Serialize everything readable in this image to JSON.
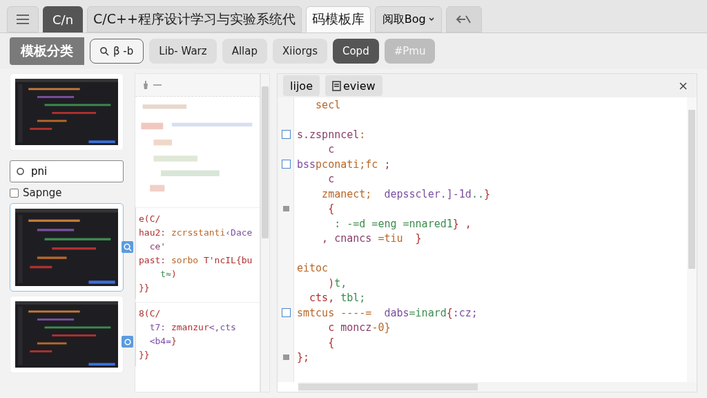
{
  "top_bar": {
    "app_badge": "C/n",
    "tabs": [
      {
        "label": "C/C++程序设计学习与实验系统代",
        "selected": false
      },
      {
        "label": "码模板库",
        "selected": true
      }
    ],
    "account_menu": {
      "label": "阅取Bog"
    }
  },
  "filter_bar": {
    "title": "模板分类",
    "filters": [
      {
        "kind": "search",
        "label": "β -b",
        "selected": false,
        "disabled": false
      },
      {
        "kind": "chip",
        "label": "Lib- Warz",
        "selected": false,
        "disabled": false
      },
      {
        "kind": "chip",
        "label": "Allap",
        "selected": false,
        "disabled": false
      },
      {
        "kind": "chip",
        "label": "Xiiorgs",
        "selected": false,
        "disabled": false
      },
      {
        "kind": "chip",
        "label": "Copd",
        "selected": true,
        "disabled": false
      },
      {
        "kind": "chip",
        "label": "#Pmu",
        "selected": false,
        "disabled": true
      }
    ]
  },
  "library": {
    "search": {
      "value": "pni"
    },
    "sample_toggle": {
      "label": "Sapnge",
      "checked": false
    },
    "cards": [
      {
        "selected": false
      },
      {
        "selected": true
      },
      {
        "selected": false
      }
    ],
    "snippets": [
      {
        "kind": "search",
        "lines": [
          [
            {
              "kind": "br",
              "text": "e(C/"
            }
          ],
          [
            {
              "kind": "br",
              "text": "hau2: "
            },
            {
              "kind": "kw",
              "text": "zcrsstanti"
            },
            {
              "kind": "fn",
              "text": "‹Dace"
            }
          ],
          [
            {
              "kind": "id",
              "text": "  ce'"
            }
          ],
          [
            {
              "kind": "br",
              "text": "past: "
            },
            {
              "kind": "kw",
              "text": "sorbo "
            },
            {
              "kind": "br",
              "text": "T'ncIL{bu"
            }
          ],
          [
            {
              "kind": "str",
              "text": "    t≈"
            },
            {
              "kind": "br",
              "text": ")"
            }
          ],
          [
            {
              "kind": "br",
              "text": "}}"
            }
          ]
        ]
      },
      {
        "kind": "circle",
        "lines": [
          [
            {
              "kind": "br",
              "text": "8(C/"
            }
          ],
          [
            {
              "kind": "fn",
              "text": "  t7: "
            },
            {
              "kind": "br",
              "text": "zmanzur"
            },
            {
              "kind": "fn",
              "text": "<,cts"
            }
          ],
          [
            {
              "kind": "fn",
              "text": "  <b4="
            },
            {
              "kind": "br",
              "text": "}"
            }
          ],
          [
            {
              "kind": "br",
              "text": "}}"
            }
          ]
        ]
      }
    ]
  },
  "editor": {
    "tabs": [
      {
        "label": "lijoe"
      },
      {
        "label": "eview"
      }
    ],
    "lines": [
      {
        "kind": "plain",
        "tokens": [
          {
            "kind": "kw",
            "text": "   secl"
          }
        ]
      },
      {
        "kind": "plain"
      },
      {
        "kind": "checkbox",
        "checked": false,
        "tokens": [
          {
            "kind": "id",
            "text": "s.zspnncel"
          },
          {
            "kind": "kw",
            "text": ":"
          }
        ]
      },
      {
        "kind": "plain",
        "tokens": [
          {
            "kind": "id",
            "text": "     c"
          }
        ]
      },
      {
        "kind": "checkbox",
        "checked": false,
        "tokens": [
          {
            "kind": "fn",
            "text": "bss"
          },
          {
            "kind": "kw",
            "text": "pconati;fc"
          },
          {
            "kind": "id",
            "text": " ;"
          }
        ]
      },
      {
        "kind": "plain",
        "tokens": [
          {
            "kind": "id",
            "text": "     c"
          }
        ]
      },
      {
        "kind": "plain",
        "tokens": [
          {
            "kind": "kw",
            "text": "    zmanect;  "
          },
          {
            "kind": "fn",
            "text": "depsscler.]-1d"
          },
          {
            "kind": "str",
            "text": ".."
          },
          {
            "kind": "br",
            "text": "}"
          }
        ]
      },
      {
        "kind": "breakpoint",
        "tokens": [
          {
            "kind": "br",
            "text": "     {"
          }
        ]
      },
      {
        "kind": "plain",
        "tokens": [
          {
            "kind": "str",
            "text": "      : -=d =eng =nnared1"
          },
          {
            "kind": "br",
            "text": "} ,"
          }
        ]
      },
      {
        "kind": "plain",
        "tokens": [
          {
            "kind": "id",
            "text": "    , cnancs "
          },
          {
            "kind": "kw",
            "text": "=tiu  "
          },
          {
            "kind": "br",
            "text": "}"
          }
        ]
      },
      {
        "kind": "plain"
      },
      {
        "kind": "plain",
        "tokens": [
          {
            "kind": "kw",
            "text": "eitoc"
          }
        ]
      },
      {
        "kind": "plain",
        "tokens": [
          {
            "kind": "br",
            "text": "     )"
          },
          {
            "kind": "str",
            "text": "t,"
          }
        ]
      },
      {
        "kind": "plain",
        "tokens": [
          {
            "kind": "br",
            "text": "  cts, "
          },
          {
            "kind": "str",
            "text": "tbl;"
          }
        ]
      },
      {
        "kind": "checkbox",
        "checked": false,
        "tokens": [
          {
            "kind": "kw",
            "text": "smtcus ----=  "
          },
          {
            "kind": "fn",
            "text": "dabs"
          },
          {
            "kind": "str",
            "text": "=inard"
          },
          {
            "kind": "br",
            "text": "{"
          },
          {
            "kind": "fn",
            "text": ":cz;"
          }
        ]
      },
      {
        "kind": "plain",
        "tokens": [
          {
            "kind": "br",
            "text": "     c "
          },
          {
            "kind": "id",
            "text": "moncz"
          },
          {
            "kind": "kw",
            "text": "-0}"
          }
        ]
      },
      {
        "kind": "plain",
        "tokens": [
          {
            "kind": "br",
            "text": "     {"
          }
        ]
      },
      {
        "kind": "breakpoint",
        "tokens": [
          {
            "kind": "br",
            "text": "};"
          }
        ]
      }
    ]
  }
}
